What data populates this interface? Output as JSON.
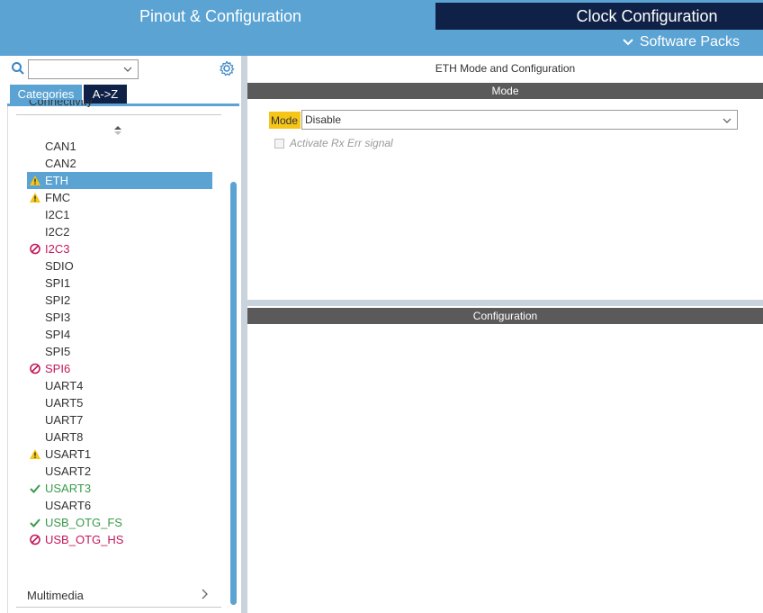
{
  "header": {
    "tab_pinout": "Pinout & Configuration",
    "tab_clock": "Clock Configuration",
    "software_packs": "Software Packs"
  },
  "left": {
    "search_value": "",
    "tabs": [
      "Categories",
      "A->Z"
    ],
    "group_partial": "Connectivity",
    "items": [
      {
        "label": "CAN1",
        "status": "none"
      },
      {
        "label": "CAN2",
        "status": "none"
      },
      {
        "label": "ETH",
        "status": "warning",
        "selected": true
      },
      {
        "label": "FMC",
        "status": "warning"
      },
      {
        "label": "I2C1",
        "status": "none"
      },
      {
        "label": "I2C2",
        "status": "none"
      },
      {
        "label": "I2C3",
        "status": "disabled"
      },
      {
        "label": "SDIO",
        "status": "none"
      },
      {
        "label": "SPI1",
        "status": "none"
      },
      {
        "label": "SPI2",
        "status": "none"
      },
      {
        "label": "SPI3",
        "status": "none"
      },
      {
        "label": "SPI4",
        "status": "none"
      },
      {
        "label": "SPI5",
        "status": "none"
      },
      {
        "label": "SPI6",
        "status": "disabled"
      },
      {
        "label": "UART4",
        "status": "none"
      },
      {
        "label": "UART5",
        "status": "none"
      },
      {
        "label": "UART7",
        "status": "none"
      },
      {
        "label": "UART8",
        "status": "none"
      },
      {
        "label": "USART1",
        "status": "warning"
      },
      {
        "label": "USART2",
        "status": "none"
      },
      {
        "label": "USART3",
        "status": "ok"
      },
      {
        "label": "USART6",
        "status": "none"
      },
      {
        "label": "USB_OTG_FS",
        "status": "ok"
      },
      {
        "label": "USB_OTG_HS",
        "status": "disabled"
      }
    ],
    "multimedia": "Multimedia"
  },
  "right": {
    "title": "ETH Mode and Configuration",
    "mode_section": "Mode",
    "mode_label": "Mode",
    "mode_value": "Disable",
    "checkbox_label": "Activate Rx Err signal",
    "config_section": "Configuration"
  },
  "colors": {
    "accent": "#5ba3d3",
    "dark_tab": "#0f2147",
    "warning": "#f5c518",
    "disabled": "#c2185b",
    "ok": "#3a9b4a"
  }
}
